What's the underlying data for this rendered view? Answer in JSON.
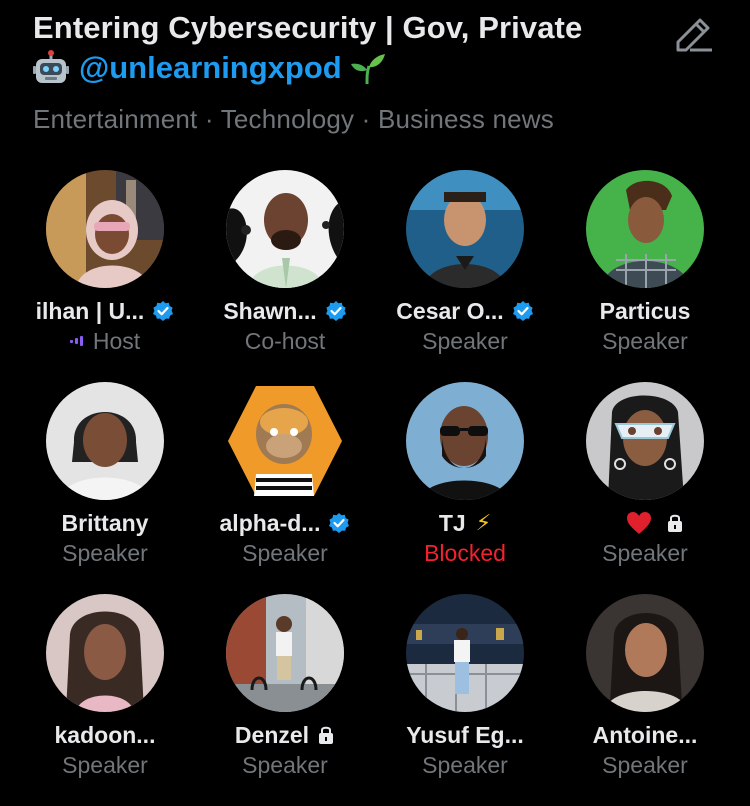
{
  "space": {
    "title": "Entering Cybersecurity | Gov, Private",
    "handle_emoji_left": "robot-face",
    "handle": "@unlearningxpod",
    "handle_emoji_right": "seedling",
    "topics": "Entertainment · Technology · Business news",
    "edit_icon": "pencil-icon"
  },
  "colors": {
    "background": "#000000",
    "text": "#e7e9ea",
    "muted": "#71767b",
    "link": "#1d9bf0",
    "verified": "#1d9bf0",
    "blocked": "#f4212e",
    "speaking": "#8b5cf6"
  },
  "participants": [
    {
      "name": "ilhan | U...",
      "role": "Host",
      "verified": true,
      "speaking": true
    },
    {
      "name": "Shawn...",
      "role": "Co-host",
      "verified": true
    },
    {
      "name": "Cesar O...",
      "role": "Speaker",
      "verified": true
    },
    {
      "name": "Particus",
      "role": "Speaker"
    },
    {
      "name": "Brittany",
      "role": "Speaker"
    },
    {
      "name": "alpha-d...",
      "role": "Speaker",
      "verified": true
    },
    {
      "name": "TJ",
      "role": "Blocked",
      "suffix": "⚡"
    },
    {
      "name": "",
      "role": "Speaker",
      "heart": true,
      "locked": true
    },
    {
      "name": "kadoon...",
      "role": "Speaker"
    },
    {
      "name": "Denzel",
      "role": "Speaker",
      "locked": true
    },
    {
      "name": "Yusuf Eg...",
      "role": "Speaker"
    },
    {
      "name": "Antoine...",
      "role": "Speaker"
    }
  ]
}
